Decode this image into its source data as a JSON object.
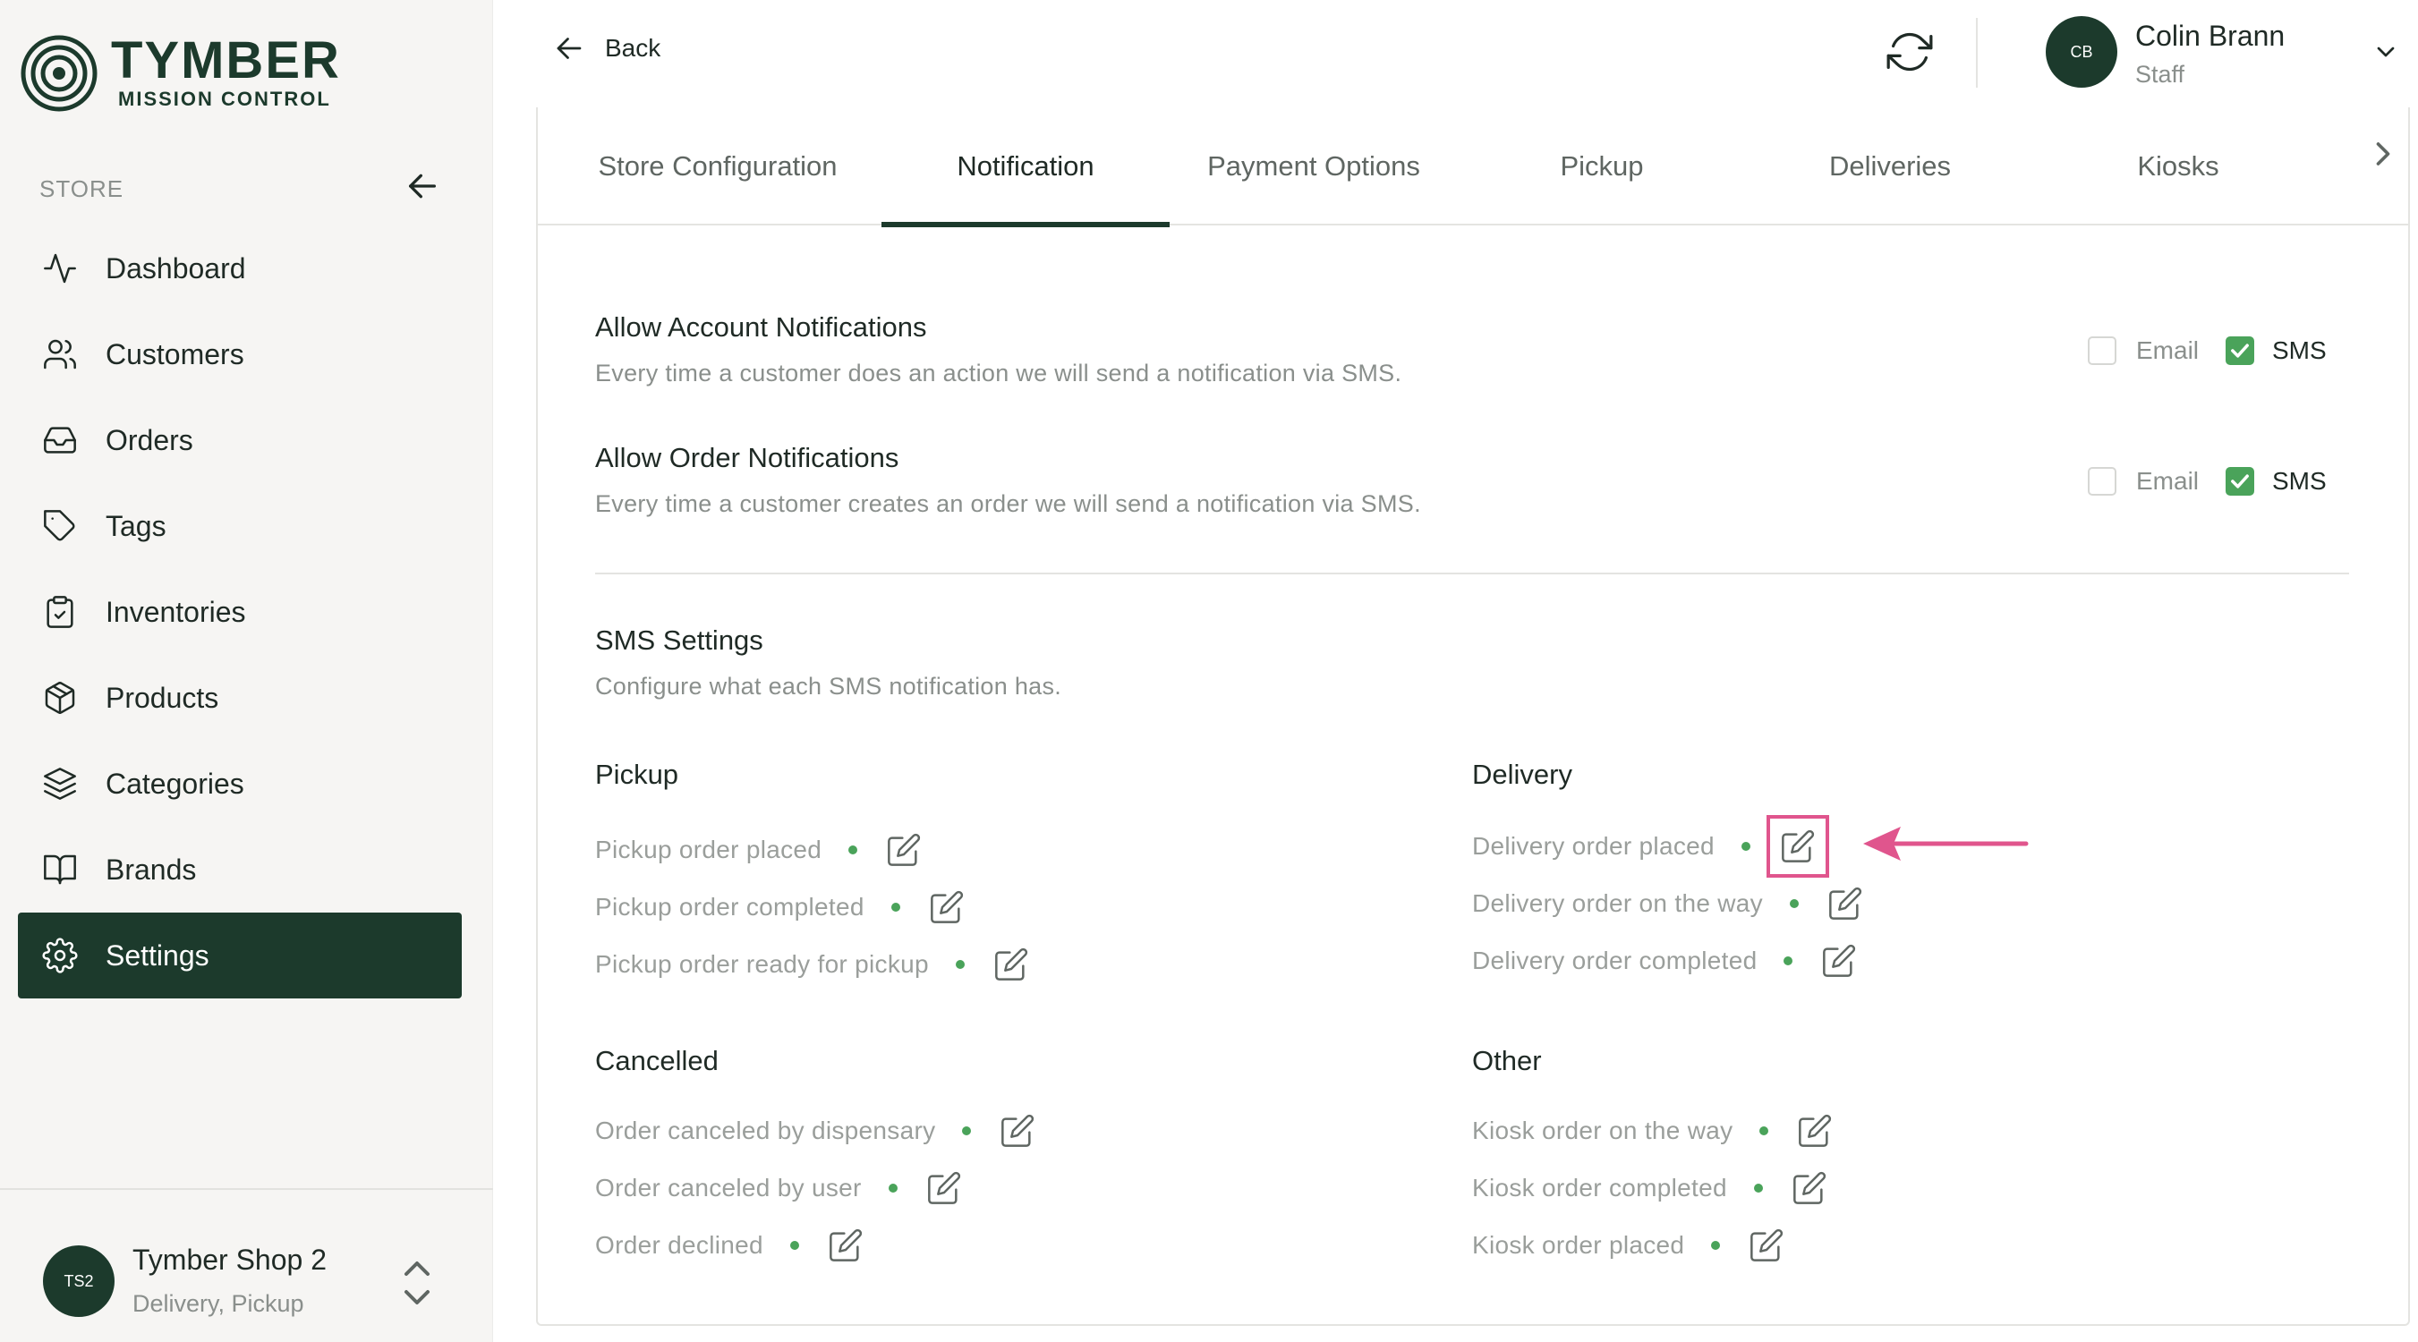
{
  "brand": {
    "title": "TYMBER",
    "subtitle": "MISSION CONTROL",
    "color": "#1c3a2c"
  },
  "sidebar": {
    "section_label": "STORE",
    "items": [
      {
        "label": "Dashboard",
        "icon": "activity-icon"
      },
      {
        "label": "Customers",
        "icon": "users-icon"
      },
      {
        "label": "Orders",
        "icon": "inbox-icon"
      },
      {
        "label": "Tags",
        "icon": "tag-icon"
      },
      {
        "label": "Inventories",
        "icon": "clipboard-check-icon"
      },
      {
        "label": "Products",
        "icon": "package-icon"
      },
      {
        "label": "Categories",
        "icon": "layers-icon"
      },
      {
        "label": "Brands",
        "icon": "book-open-icon"
      },
      {
        "label": "Settings",
        "icon": "gear-icon",
        "active": true
      }
    ],
    "store": {
      "initials": "TS2",
      "name": "Tymber Shop 2",
      "types": "Delivery, Pickup"
    }
  },
  "header": {
    "back_label": "Back",
    "user": {
      "initials": "CB",
      "name": "Colin Brann",
      "role": "Staff"
    }
  },
  "tabs": [
    {
      "label": "Store Configuration"
    },
    {
      "label": "Notification",
      "active": true
    },
    {
      "label": "Payment Options"
    },
    {
      "label": "Pickup"
    },
    {
      "label": "Deliveries"
    },
    {
      "label": "Kiosks"
    }
  ],
  "notifications": {
    "account": {
      "title": "Allow Account Notifications",
      "description": "Every time a customer does an action we will send a notification via SMS.",
      "email_label": "Email",
      "email_checked": false,
      "sms_label": "SMS",
      "sms_checked": true
    },
    "order": {
      "title": "Allow Order Notifications",
      "description": "Every time a customer creates an order we will send a notification via SMS.",
      "email_label": "Email",
      "email_checked": false,
      "sms_label": "SMS",
      "sms_checked": true
    }
  },
  "sms_settings": {
    "title": "SMS Settings",
    "description": "Configure what each SMS notification has.",
    "pickup": {
      "title": "Pickup",
      "items": [
        "Pickup order placed",
        "Pickup order completed",
        "Pickup order ready for pickup"
      ]
    },
    "delivery": {
      "title": "Delivery",
      "items": [
        "Delivery order placed",
        "Delivery order on the way",
        "Delivery order completed"
      ]
    },
    "cancelled": {
      "title": "Cancelled",
      "items": [
        "Order canceled by dispensary",
        "Order canceled by user",
        "Order declined"
      ]
    },
    "other": {
      "title": "Other",
      "items": [
        "Kiosk order on the way",
        "Kiosk order completed",
        "Kiosk order placed"
      ]
    }
  },
  "colors": {
    "accent": "#1c3a2c",
    "check": "#4aa35a",
    "highlight": "#e0558d"
  }
}
